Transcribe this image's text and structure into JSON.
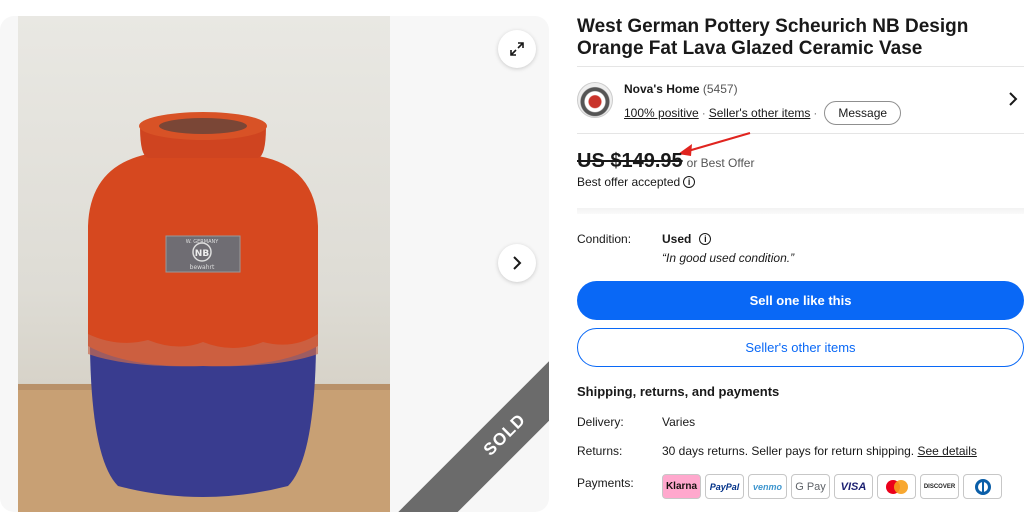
{
  "listing": {
    "title": "West German Pottery Scheurich NB Design Orange Fat Lava Glazed Ceramic Vase",
    "sold_label": "SOLD",
    "vase_label_top": "W. GERMANY",
    "vase_label_mark": "NB",
    "vase_label_bottom": "bewahrt"
  },
  "seller": {
    "name": "Nova's Home",
    "feedback_count": "(5457)",
    "positive": "100% positive",
    "separator": "·",
    "other_items": "Seller's other items",
    "message": "Message"
  },
  "pricing": {
    "price": "US $149.95",
    "best_offer": "or Best Offer",
    "accepted": "Best offer accepted"
  },
  "condition": {
    "label": "Condition:",
    "value": "Used",
    "note": "“In good used condition.”"
  },
  "actions": {
    "sell_one": "Sell one like this",
    "sellers_other": "Seller's other items"
  },
  "shipping": {
    "heading": "Shipping, returns, and payments",
    "delivery_label": "Delivery:",
    "delivery_value": "Varies",
    "returns_label": "Returns:",
    "returns_value": "30 days returns. Seller pays for return shipping.",
    "see_details": "See details",
    "payments_label": "Payments:",
    "methods": [
      "Klarna",
      "PayPal",
      "venmo",
      "G Pay",
      "VISA",
      "Mastercard",
      "DISCOVER",
      "Diners Club"
    ]
  },
  "colors": {
    "accent_blue": "#0968f6",
    "arrow_red": "#e0241f",
    "vase_orange": "#d9461f",
    "vase_blue": "#3a3d8c"
  }
}
